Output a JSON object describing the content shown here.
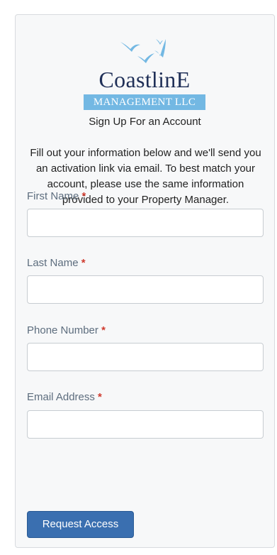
{
  "logo": {
    "wordmark": "CoastlinE",
    "subtitle": "MANAGEMENT LLC"
  },
  "heading": "Sign Up For an Account",
  "intro": "Fill out your information below and we'll send you an activation link via email. To best match your account, please use the same information provided to your Property Manager.",
  "form": {
    "required_marker": "*",
    "fields": [
      {
        "label": "First Name",
        "value": "",
        "placeholder": ""
      },
      {
        "label": "Last Name",
        "value": "",
        "placeholder": ""
      },
      {
        "label": "Phone Number",
        "value": "",
        "placeholder": ""
      },
      {
        "label": "Email Address",
        "value": "",
        "placeholder": ""
      }
    ],
    "submit_label": "Request Access"
  },
  "colors": {
    "brand_navy": "#1f2f57",
    "brand_sky": "#73b8e3",
    "button_blue": "#3a6fb0",
    "required_red": "#cf3b2f",
    "label_gray": "#5d6d7e"
  },
  "icons": {
    "logo_mark": "seagulls-icon"
  }
}
